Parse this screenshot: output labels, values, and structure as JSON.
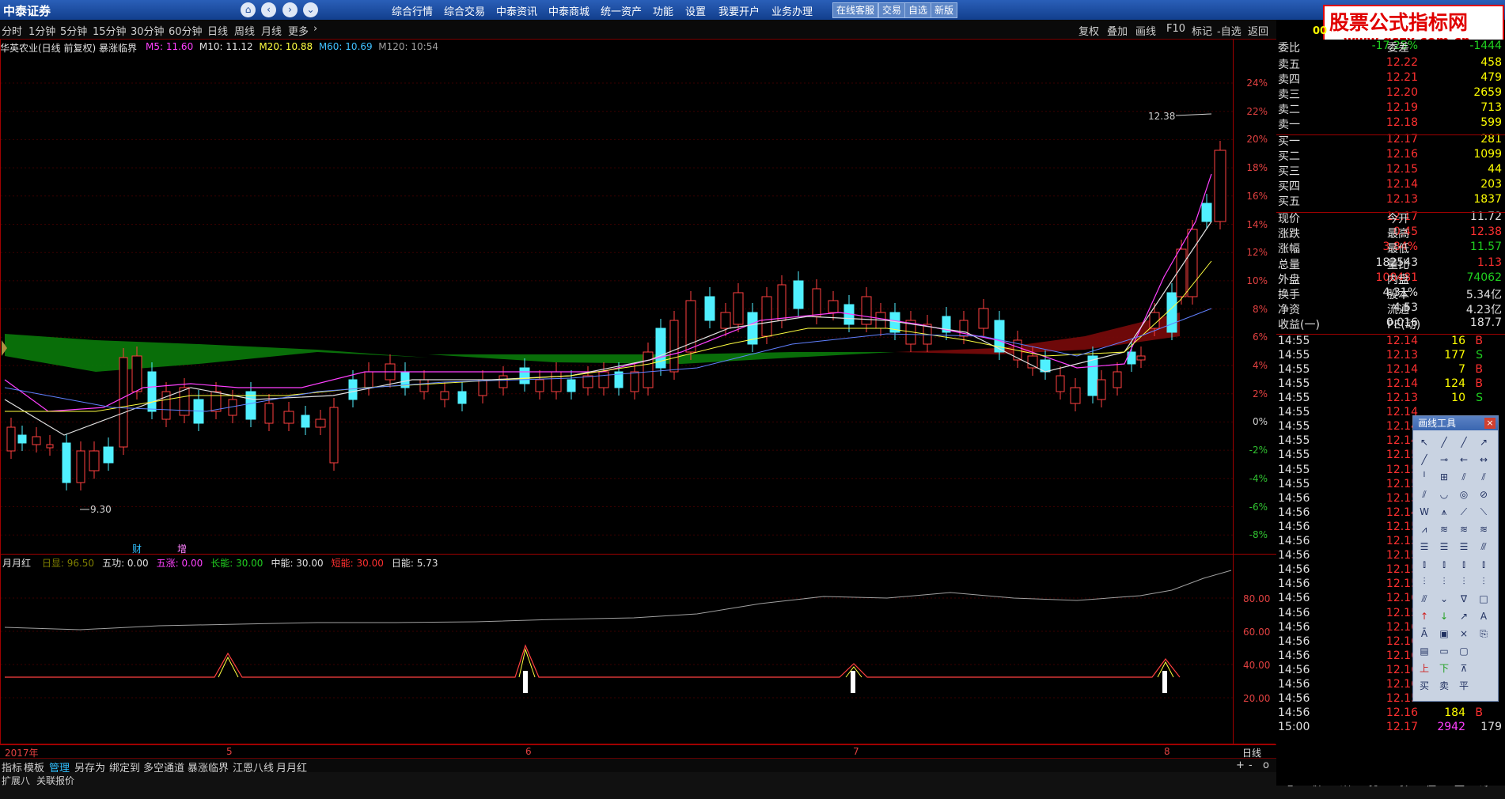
{
  "titlebar": {
    "logo": "中泰证券",
    "menu": [
      "综合行情",
      "综合交易",
      "中泰资讯",
      "中泰商城",
      "统一资产",
      "功能",
      "设置",
      "我要开户",
      "业务办理"
    ],
    "buttons": [
      "在线客服",
      "交易",
      "自选",
      "新版"
    ]
  },
  "watermark": {
    "line1": "股票公式指标网",
    "line2": "www.gszx.com.cn"
  },
  "periodbar": {
    "periods": [
      "分时",
      "1分钟",
      "5分钟",
      "15分钟",
      "30分钟",
      "60分钟",
      "日线",
      "周线",
      "月线",
      "更多"
    ],
    "right": [
      "复权",
      "叠加",
      "画线",
      "F10",
      "标记",
      "-自选",
      "返回"
    ]
  },
  "stock": {
    "name": "华英农业(日线 前复权) 暴涨临界",
    "ma": [
      {
        "label": "M5: 11.60",
        "color": "#ff40ff"
      },
      {
        "label": "M10: 11.12",
        "color": "#e0e0e0"
      },
      {
        "label": "M20: 10.88",
        "color": "#ffff40"
      },
      {
        "label": "M60: 10.69",
        "color": "#40c0ff"
      },
      {
        "label": "M120: 10:54",
        "color": "#a0a0a0"
      }
    ]
  },
  "main_chart": {
    "y_pct_labels": [
      "24%",
      "22%",
      "20%",
      "18%",
      "16%",
      "14%",
      "12%",
      "10%",
      "8%",
      "6%",
      "4%",
      "2%",
      "0%",
      "-2%",
      "-4%",
      "-6%",
      "-8%"
    ],
    "high_mark": "12.38",
    "low_mark": "9.30",
    "markers": [
      "财",
      "增"
    ]
  },
  "indicator": {
    "name": "月月红",
    "items": [
      {
        "label": "日显:",
        "value": "96.50",
        "color": "#808000"
      },
      {
        "label": "五功:",
        "value": "0.00",
        "color": "#e0e0e0"
      },
      {
        "label": "五涨:",
        "value": "0.00",
        "color": "#ff40ff"
      },
      {
        "label": "长能:",
        "value": "30.00",
        "color": "#20d020"
      },
      {
        "label": "中能:",
        "value": "30.00",
        "color": "#e0e0e0"
      },
      {
        "label": "短能:",
        "value": "30.00",
        "color": "#ff3030"
      },
      {
        "label": "日能:",
        "value": "5.73",
        "color": "#e0e0e0"
      }
    ],
    "y_labels": [
      "80.00",
      "60.00",
      "40.00",
      "20.00"
    ]
  },
  "xaxis": {
    "labels": [
      "2017年",
      "5",
      "6",
      "7",
      "8"
    ],
    "period": "日线"
  },
  "bottombar": {
    "tabs": [
      "指标",
      "模板",
      "管理",
      "另存为",
      "绑定到",
      "多空通道",
      "暴涨临界",
      "江恩八线",
      "月月红"
    ],
    "active": "管理"
  },
  "statusbar": {
    "items": [
      "扩展八",
      "关联报价"
    ],
    "right_tabs": [
      "笔",
      "价",
      "细",
      "势",
      "联",
      "值",
      "主",
      "筹"
    ]
  },
  "quote": {
    "header": [
      {
        "k": "委比",
        "v": "-17.25%",
        "k2": "委差",
        "v2": "-1444"
      }
    ],
    "sells": [
      {
        "label": "卖五",
        "price": "12.22",
        "vol": "458"
      },
      {
        "label": "卖四",
        "price": "12.21",
        "vol": "479"
      },
      {
        "label": "卖三",
        "price": "12.20",
        "vol": "2659"
      },
      {
        "label": "卖二",
        "price": "12.19",
        "vol": "713"
      },
      {
        "label": "卖一",
        "price": "12.18",
        "vol": "599"
      }
    ],
    "buys": [
      {
        "label": "买一",
        "price": "12.17",
        "vol": "281"
      },
      {
        "label": "买二",
        "price": "12.16",
        "vol": "1099"
      },
      {
        "label": "买三",
        "price": "12.15",
        "vol": "44"
      },
      {
        "label": "买四",
        "price": "12.14",
        "vol": "203"
      },
      {
        "label": "买五",
        "price": "12.13",
        "vol": "1837"
      }
    ],
    "stats": [
      {
        "k": "现价",
        "v": "12.17",
        "vc": "red",
        "k2": "今开",
        "v2": "11.72",
        "v2c": "wht"
      },
      {
        "k": "涨跌",
        "v": "0.45",
        "vc": "red",
        "k2": "最高",
        "v2": "12.38",
        "v2c": "red"
      },
      {
        "k": "涨幅",
        "v": "3.84%",
        "vc": "red",
        "k2": "最低",
        "v2": "11.57",
        "v2c": "grn"
      },
      {
        "k": "总量",
        "v": "182543",
        "vc": "wht",
        "k2": "量比",
        "v2": "1.13",
        "v2c": "red"
      },
      {
        "k": "外盘",
        "v": "108481",
        "vc": "red",
        "k2": "内盘",
        "v2": "74062",
        "v2c": "grn"
      },
      {
        "k": "换手",
        "v": "4.31%",
        "vc": "wht",
        "k2": "股本",
        "v2": "5.34亿",
        "v2c": "wht"
      },
      {
        "k": "净资",
        "v": "4.53",
        "vc": "wht",
        "k2": "流通",
        "v2": "4.23亿",
        "v2c": "wht"
      },
      {
        "k": "收益(一)",
        "v": "0.016",
        "vc": "wht",
        "k2": "PE(动)",
        "v2": "187.7",
        "v2c": "wht"
      }
    ],
    "ticks": [
      {
        "t": "14:55",
        "p": "12.14",
        "pc": "red",
        "v": "16",
        "bs": "B"
      },
      {
        "t": "14:55",
        "p": "12.13",
        "pc": "red",
        "v": "177",
        "bs": "S"
      },
      {
        "t": "14:55",
        "p": "12.14",
        "pc": "red",
        "v": "7",
        "bs": "B"
      },
      {
        "t": "14:55",
        "p": "12.14",
        "pc": "red",
        "v": "124",
        "bs": "B"
      },
      {
        "t": "14:55",
        "p": "12.13",
        "pc": "red",
        "v": "10",
        "bs": "S"
      },
      {
        "t": "14:55",
        "p": "12.14",
        "pc": "red",
        "v": "",
        "bs": ""
      },
      {
        "t": "14:55",
        "p": "12.14",
        "pc": "red",
        "v": "",
        "bs": ""
      },
      {
        "t": "14:55",
        "p": "12.14",
        "pc": "red",
        "v": "",
        "bs": ""
      },
      {
        "t": "14:55",
        "p": "12.15",
        "pc": "red",
        "v": "",
        "bs": ""
      },
      {
        "t": "14:55",
        "p": "12.15",
        "pc": "red",
        "v": "",
        "bs": ""
      },
      {
        "t": "14:55",
        "p": "12.15",
        "pc": "red",
        "v": "",
        "bs": ""
      },
      {
        "t": "14:56",
        "p": "12.15",
        "pc": "red",
        "v": "",
        "bs": ""
      },
      {
        "t": "14:56",
        "p": "12.14",
        "pc": "red",
        "v": "",
        "bs": ""
      },
      {
        "t": "14:56",
        "p": "12.15",
        "pc": "red",
        "v": "",
        "bs": ""
      },
      {
        "t": "14:56",
        "p": "12.15",
        "pc": "red",
        "v": "",
        "bs": ""
      },
      {
        "t": "14:56",
        "p": "12.15",
        "pc": "red",
        "v": "",
        "bs": ""
      },
      {
        "t": "14:56",
        "p": "12.15",
        "pc": "red",
        "v": "",
        "bs": ""
      },
      {
        "t": "14:56",
        "p": "12.15",
        "pc": "red",
        "v": "",
        "bs": ""
      },
      {
        "t": "14:56",
        "p": "12.16",
        "pc": "red",
        "v": "",
        "bs": ""
      },
      {
        "t": "14:56",
        "p": "12.15",
        "pc": "red",
        "v": "",
        "bs": ""
      },
      {
        "t": "14:56",
        "p": "12.16",
        "pc": "red",
        "v": "",
        "bs": ""
      },
      {
        "t": "14:56",
        "p": "12.16",
        "pc": "red",
        "v": "",
        "bs": ""
      },
      {
        "t": "14:56",
        "p": "12.16",
        "pc": "red",
        "v": "",
        "bs": ""
      },
      {
        "t": "14:56",
        "p": "12.16",
        "pc": "red",
        "v": "41",
        "bs": ""
      },
      {
        "t": "14:56",
        "p": "12.16",
        "pc": "red",
        "v": "14",
        "bs": "B"
      },
      {
        "t": "14:56",
        "p": "12.15",
        "pc": "red",
        "v": "1",
        "bs": "S"
      },
      {
        "t": "14:56",
        "p": "12.16",
        "pc": "red",
        "v": "184",
        "bs": "B"
      },
      {
        "t": "15:00",
        "p": "12.17",
        "pc": "red",
        "v": "2942",
        "bs": ""
      }
    ],
    "tick_last_extra": "179",
    "top_label": "00"
  },
  "drawtools": {
    "title": "画线工具"
  }
}
